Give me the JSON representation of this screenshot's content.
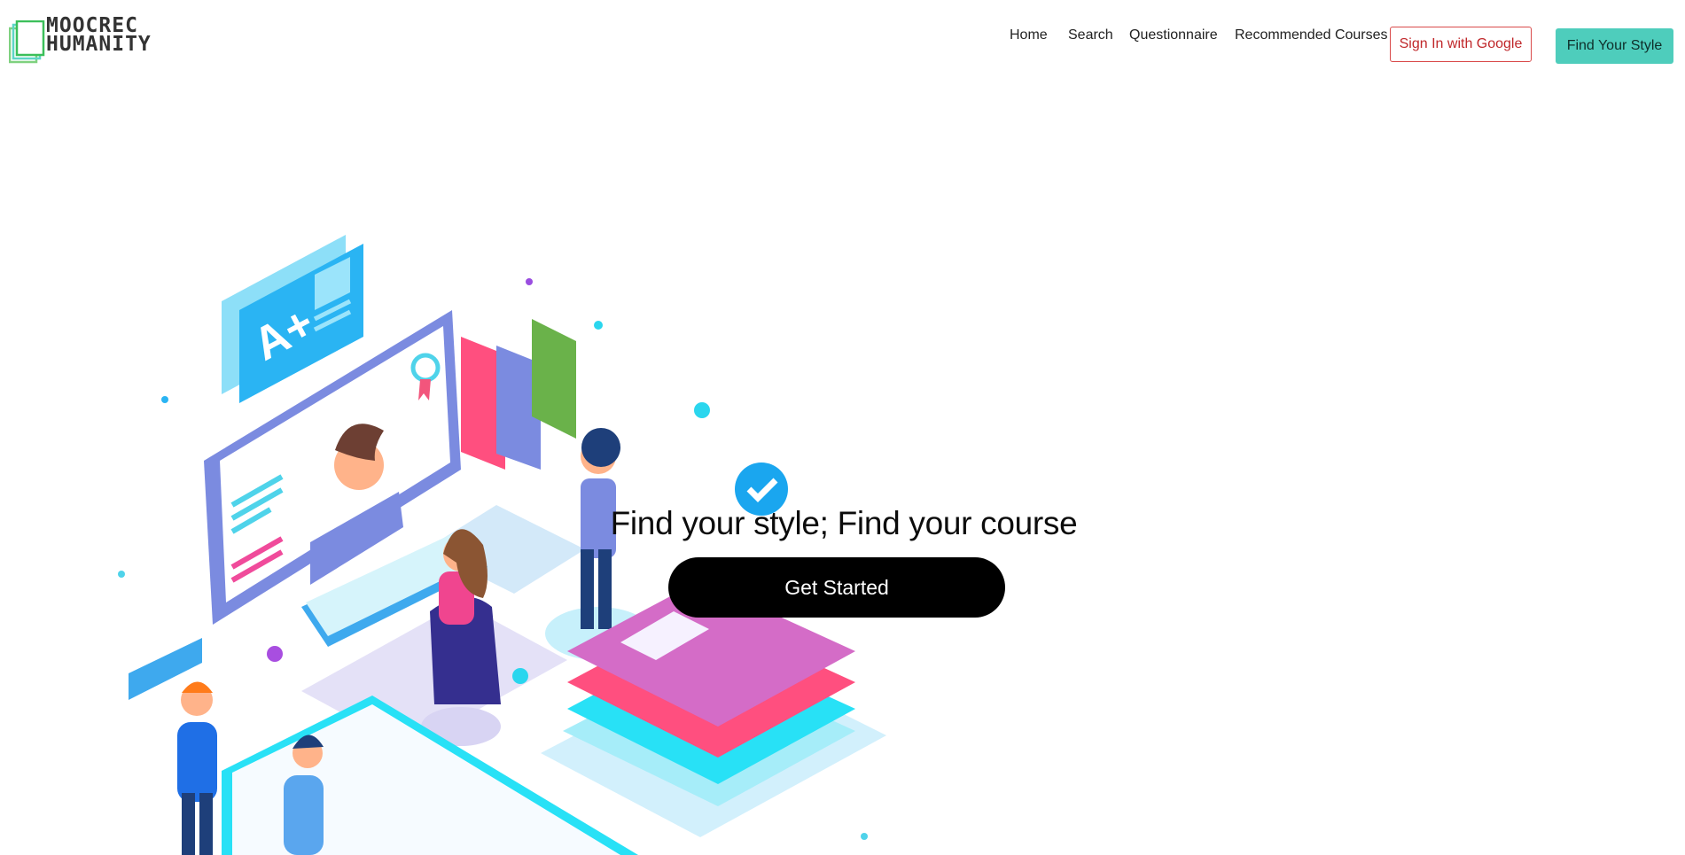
{
  "brand": {
    "line1": "MOOCREC",
    "line2": "HUMANITY",
    "colors": {
      "accent": "#4ecdbc",
      "logo_green": "#3bbf5a",
      "logo_teal": "#5ed6c6"
    }
  },
  "nav": {
    "home": "Home",
    "search": "Search",
    "questionnaire": "Questionnaire",
    "recommended": "Recommended Courses",
    "google_signin": "Sign In with Google",
    "find_style": "Find Your Style"
  },
  "hero": {
    "headline": "Find your style; Find your course",
    "cta_label": "Get Started",
    "illustration": {
      "grade_card_text": "A+",
      "icon": "education-isometric-illustration"
    }
  },
  "colors": {
    "cta_bg": "#000000",
    "google_border": "#d94a4a",
    "find_style_bg": "#4ecdbc"
  }
}
